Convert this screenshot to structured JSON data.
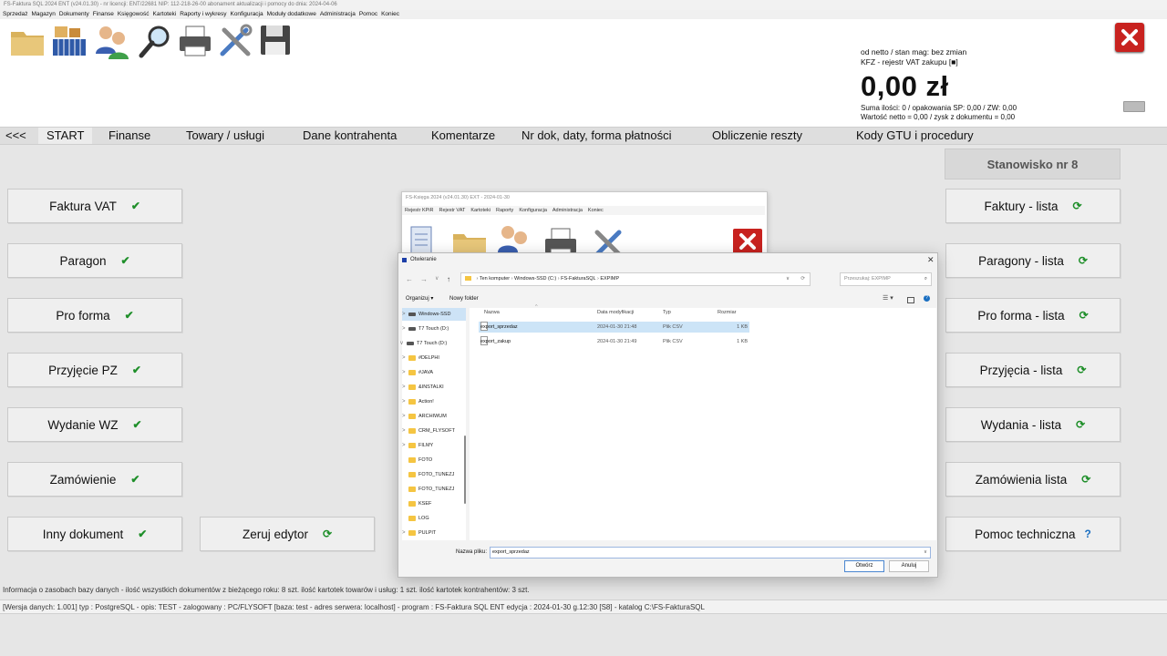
{
  "window": {
    "title": "FS-Faktura SQL 2024 ENT (v24.01.30)    -   nr licencji: ENT/22681    NIP: 112-218-26-00    abonament aktualizacji i pomocy do dnia: 2024-04-06"
  },
  "menu": [
    "Sprzedaż",
    "Magazyn",
    "Dokumenty",
    "Finanse",
    "Księgowość",
    "Kartoteki",
    "Raporty i wykresy",
    "Konfiguracja",
    "Moduły dodatkowe",
    "Administracja",
    "Pomoc",
    "Koniec"
  ],
  "toolbar": {
    "icons": [
      "folder-icon",
      "warehouse-icon",
      "contacts-icon",
      "magnifier-icon",
      "printer-icon",
      "tools-icon",
      "floppy-disk-icon"
    ]
  },
  "summary": {
    "line1": "od netto / stan mag: bez zmian",
    "line2": "KFZ - rejestr VAT zakupu [■]",
    "total": "0,00 zł",
    "line3": "Suma ilości: 0 / opakowania SP: 0,00 / ZW: 0,00",
    "line4": "Wartość netto = 0,00  /  zysk z dokumentu = 0,00"
  },
  "tabs": [
    "<<<",
    "START",
    "Finanse",
    "Towary  / usługi",
    "Dane kontrahenta",
    "Komentarze",
    "Nr dok, daty, forma płatności",
    "Obliczenie reszty",
    "Kody GTU i procedury"
  ],
  "left_buttons": [
    "Faktura VAT",
    "Paragon",
    "Pro forma",
    "Przyjęcie PZ",
    "Wydanie WZ",
    "Zamówienie",
    "Inny dokument"
  ],
  "reset_button": "Zeruj edytor",
  "station": "Stanowisko nr 8",
  "right_buttons": [
    "Faktury - lista",
    "Paragony - lista",
    "Pro forma - lista",
    "Przyjęcia - lista",
    "Wydania - lista",
    "Zamówienia lista",
    "Pomoc techniczna"
  ],
  "status": {
    "info": "Informacja o zasobach bazy danych   -  ilość wszystkich dokumentów z bieżącego roku: 8 szt.       ilość kartotek towarów i usług: 1 szt.       ilość kartotek kontrahentów: 3 szt.",
    "version": "[Wersja danych: 1.001] typ : PostgreSQL - opis: TEST - zalogowany : PC/FLYSOFT [baza: test - adres serwera: localhost]   -   program :  FS-Faktura SQL ENT edycja : 2024-01-30 g.12:30 [S8] - katalog C:\\FS-FakturaSQL"
  },
  "back_window": {
    "title": "FS-Księga 2024  (v24.01.30)  EXT      -     2024-01-30",
    "menu": [
      "Rejestr KPiR",
      "Rejestr VAT",
      "Kartoteki",
      "Raporty",
      "Konfiguracja",
      "Administracja",
      "Koniec"
    ]
  },
  "dialog": {
    "title": "Otwieranie",
    "path": [
      "Ten komputer",
      "Windows-SSD (C:)",
      "FS-FakturaSQL",
      "EXPIMP"
    ],
    "search_placeholder": "Przeszukaj: EXPIMP",
    "organize": "Organizuj ▾",
    "new_folder": "Nowy folder",
    "columns": [
      "Nazwa",
      "Data modyfikacji",
      "Typ",
      "Rozmiar"
    ],
    "files": [
      {
        "name": "export_sprzedaz",
        "date": "2024-01-30 21:48",
        "type": "Plik CSV",
        "size": "1 KB",
        "selected": true
      },
      {
        "name": "export_zakup",
        "date": "2024-01-30 21:49",
        "type": "Plik CSV",
        "size": "1 KB",
        "selected": false
      }
    ],
    "tree": [
      {
        "label": "Windows-SSD",
        "kind": "drive",
        "chev": ">"
      },
      {
        "label": "T7 Touch (D:)",
        "kind": "drive",
        "chev": ">"
      },
      {
        "label": "T7 Touch (D:)",
        "kind": "drive",
        "chev": "v"
      },
      {
        "label": "#DELPHI",
        "kind": "folder",
        "chev": ">"
      },
      {
        "label": "#JAVA",
        "kind": "folder",
        "chev": ">"
      },
      {
        "label": "&INSTALKI",
        "kind": "folder",
        "chev": ">"
      },
      {
        "label": "Action!",
        "kind": "folder",
        "chev": ">"
      },
      {
        "label": "ARCHIWUM",
        "kind": "folder",
        "chev": ">"
      },
      {
        "label": "CRM_FLYSOFT",
        "kind": "folder",
        "chev": ">"
      },
      {
        "label": "FILMY",
        "kind": "folder",
        "chev": ">"
      },
      {
        "label": "FOTO",
        "kind": "folder",
        "chev": ""
      },
      {
        "label": "FOTO_TUNEZJ",
        "kind": "folder",
        "chev": ""
      },
      {
        "label": "FOTO_TUNEZJ",
        "kind": "folder",
        "chev": ""
      },
      {
        "label": "KSEF",
        "kind": "folder",
        "chev": ""
      },
      {
        "label": "LOG",
        "kind": "folder",
        "chev": ""
      },
      {
        "label": "PULPIT",
        "kind": "folder",
        "chev": ">"
      }
    ],
    "filename_label": "Nazwa pliku:",
    "filename_value": "export_sprzedaz",
    "open_button": "Otwórz",
    "cancel_button": "Anuluj"
  },
  "colors": {
    "accent_green": "#1f8f2a",
    "close_red": "#c8221f",
    "selection": "#cce4f7"
  }
}
